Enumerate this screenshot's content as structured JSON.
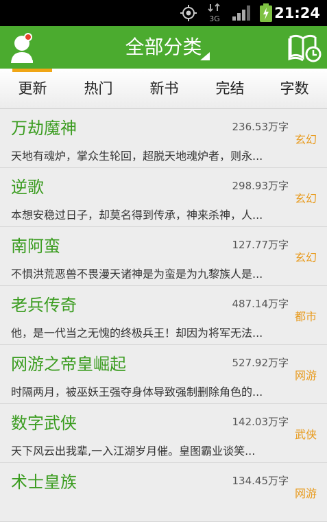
{
  "status_bar": {
    "time": "21:24",
    "network": "3G",
    "icons": [
      "gps-icon",
      "network-3g-icon",
      "signal-icon",
      "battery-charging-icon"
    ]
  },
  "header": {
    "title": "全部分类",
    "left_icon": "user-avatar-icon",
    "right_icon": "reading-history-icon",
    "dropdown_icon": "dropdown-triangle-icon"
  },
  "tabs": [
    {
      "label": "更新",
      "selected": true
    },
    {
      "label": "热门",
      "selected": false
    },
    {
      "label": "新书",
      "selected": false
    },
    {
      "label": "完结",
      "selected": false
    },
    {
      "label": "字数",
      "selected": false
    }
  ],
  "books": [
    {
      "title": "万劫魔神",
      "words": "236.53万字",
      "genre": "玄幻",
      "summary": "天地有魂炉，掌众生轮回，超脱天地魂炉者，则永..."
    },
    {
      "title": "逆歌",
      "words": "298.93万字",
      "genre": "玄幻",
      "summary": "本想安稳过日子，却莫名得到传承，神来杀神，人..."
    },
    {
      "title": "南阿蛮",
      "words": "127.77万字",
      "genre": "玄幻",
      "summary": "不惧洪荒恶兽不畏漫天诸神是为蛮是为九黎族人是..."
    },
    {
      "title": "老兵传奇",
      "words": "487.14万字",
      "genre": "都市",
      "summary": "他，是一代当之无愧的终极兵王！却因为将军无法..."
    },
    {
      "title": "网游之帝皇崛起",
      "words": "527.92万字",
      "genre": "网游",
      "summary": "时隔两月，被巫妖王强夺身体导致强制删除角色的..."
    },
    {
      "title": "数字武侠",
      "words": "142.03万字",
      "genre": "武侠",
      "summary": "天下风云出我辈,一入江湖岁月催。皇图霸业谈笑..."
    },
    {
      "title": "术士皇族",
      "words": "134.45万字",
      "genre": "网游",
      "summary": ""
    }
  ],
  "colors": {
    "header_green": "#4bab2f",
    "title_green": "#3a9c1f",
    "genre_orange": "#e89a1c",
    "tab_indicator": "#f0a616"
  }
}
